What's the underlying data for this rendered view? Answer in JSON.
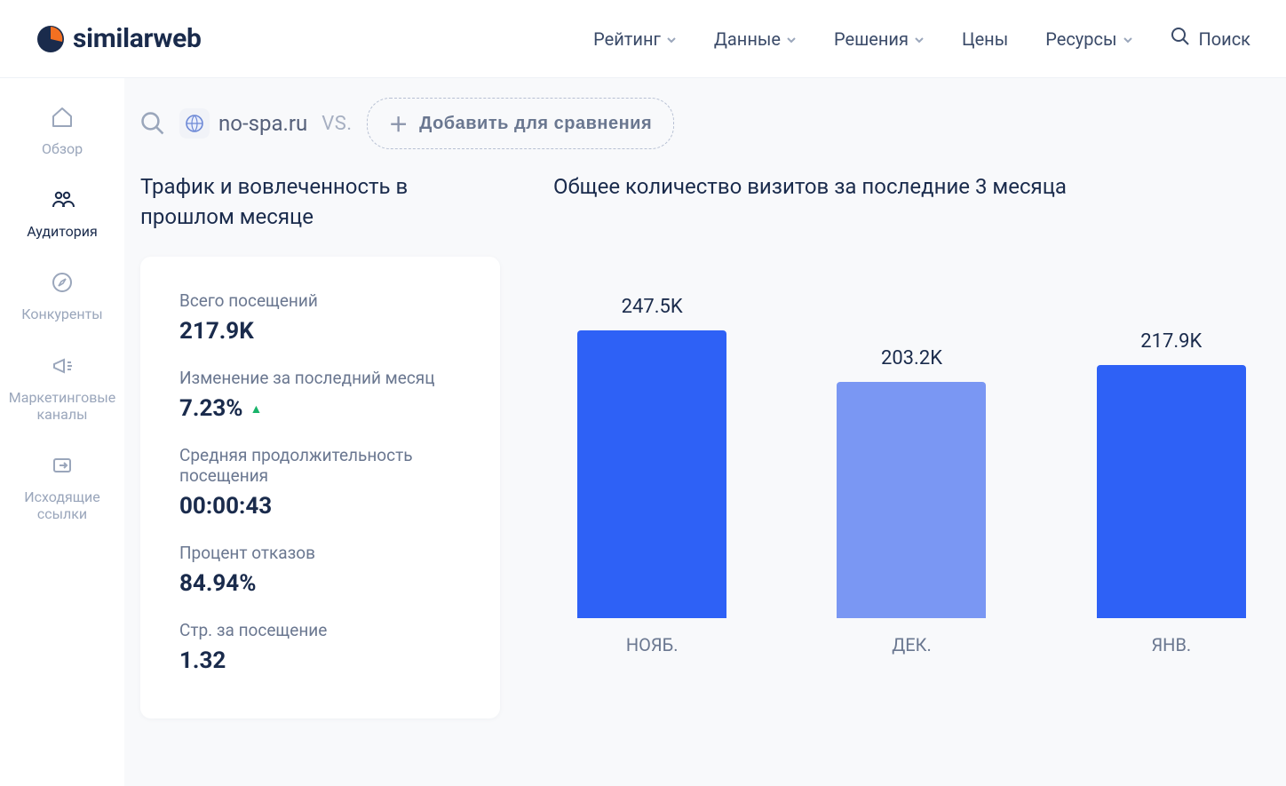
{
  "brand": {
    "name": "similarweb"
  },
  "topnav": {
    "items": [
      {
        "label": "Рейтинг"
      },
      {
        "label": "Данные"
      },
      {
        "label": "Решения"
      },
      {
        "label": "Цены"
      },
      {
        "label": "Ресурсы"
      }
    ],
    "search_label": "Поиск"
  },
  "sidebar": {
    "items": [
      {
        "label": "Обзор"
      },
      {
        "label": "Аудитория"
      },
      {
        "label": "Конкуренты"
      },
      {
        "label": "Маркетинговые каналы"
      },
      {
        "label": "Исходящие ссылки"
      }
    ]
  },
  "context": {
    "domain": "no-spa.ru",
    "vs": "VS.",
    "compare_label": "Добавить для сравнения"
  },
  "left_panel": {
    "title": "Трафик и вовлеченность в прошлом месяце",
    "metrics": [
      {
        "label": "Всего посещений",
        "value": "217.9K"
      },
      {
        "label": "Изменение за последний месяц",
        "value": "7.23%",
        "trend": "up"
      },
      {
        "label": "Средняя продолжительность посещения",
        "value": "00:00:43"
      },
      {
        "label": "Процент отказов",
        "value": "84.94%"
      },
      {
        "label": "Стр. за посещение",
        "value": "1.32"
      }
    ]
  },
  "right_panel": {
    "title": "Общее количество визитов за последние 3 месяца"
  },
  "chart_data": {
    "type": "bar",
    "categories": [
      "НОЯБ.",
      "ДЕК.",
      "ЯНВ."
    ],
    "values": [
      247.5,
      203.2,
      217.9
    ],
    "value_labels": [
      "247.5K",
      "203.2K",
      "217.9K"
    ],
    "title": "Общее количество визитов за последние 3 месяца",
    "xlabel": "",
    "ylabel": "",
    "ylim": [
      0,
      260
    ],
    "colors": [
      "#2e61f6",
      "#7a97f3",
      "#2e61f6"
    ]
  }
}
